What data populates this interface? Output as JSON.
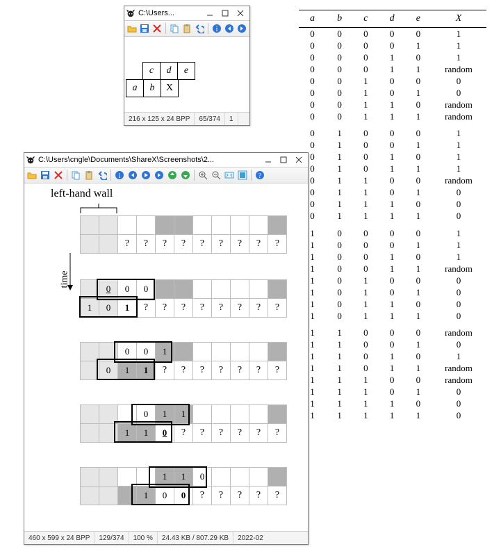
{
  "window1": {
    "title": "C:\\Users...",
    "status": {
      "dims": "216 x 125 x 24 BPP",
      "index": "65/374",
      "trail": "1"
    },
    "cells": {
      "c": "c",
      "d": "d",
      "e": "e",
      "a": "a",
      "b": "b",
      "X": "X"
    }
  },
  "window2": {
    "title": "C:\\Users\\cngle\\Documents\\ShareX\\Screenshots\\2...",
    "heading": "left-hand wall",
    "time_label": "time",
    "status": {
      "dims": "460 x 599 x 24 BPP",
      "index": "129/374",
      "zoom": "100 %",
      "size": "24.43 KB / 807.29 KB",
      "date": "2022-02"
    },
    "glyphs": {
      "zero": "0",
      "one": "1",
      "q": "?"
    }
  },
  "truth_table": {
    "headers": [
      "a",
      "b",
      "c",
      "d",
      "e",
      "X"
    ],
    "rows": [
      [
        "0",
        "0",
        "0",
        "0",
        "0",
        "1"
      ],
      [
        "0",
        "0",
        "0",
        "0",
        "1",
        "1"
      ],
      [
        "0",
        "0",
        "0",
        "1",
        "0",
        "1"
      ],
      [
        "0",
        "0",
        "0",
        "1",
        "1",
        "random"
      ],
      [
        "0",
        "0",
        "1",
        "0",
        "0",
        "0"
      ],
      [
        "0",
        "0",
        "1",
        "0",
        "1",
        "0"
      ],
      [
        "0",
        "0",
        "1",
        "1",
        "0",
        "random"
      ],
      [
        "0",
        "0",
        "1",
        "1",
        "1",
        "random"
      ],
      [
        "0",
        "1",
        "0",
        "0",
        "0",
        "1"
      ],
      [
        "0",
        "1",
        "0",
        "0",
        "1",
        "1"
      ],
      [
        "0",
        "1",
        "0",
        "1",
        "0",
        "1"
      ],
      [
        "0",
        "1",
        "0",
        "1",
        "1",
        "1"
      ],
      [
        "0",
        "1",
        "1",
        "0",
        "0",
        "random"
      ],
      [
        "0",
        "1",
        "1",
        "0",
        "1",
        "0"
      ],
      [
        "0",
        "1",
        "1",
        "1",
        "0",
        "0"
      ],
      [
        "0",
        "1",
        "1",
        "1",
        "1",
        "0"
      ],
      [
        "1",
        "0",
        "0",
        "0",
        "0",
        "1"
      ],
      [
        "1",
        "0",
        "0",
        "0",
        "1",
        "1"
      ],
      [
        "1",
        "0",
        "0",
        "1",
        "0",
        "1"
      ],
      [
        "1",
        "0",
        "0",
        "1",
        "1",
        "random"
      ],
      [
        "1",
        "0",
        "1",
        "0",
        "0",
        "0"
      ],
      [
        "1",
        "0",
        "1",
        "0",
        "1",
        "0"
      ],
      [
        "1",
        "0",
        "1",
        "1",
        "0",
        "0"
      ],
      [
        "1",
        "0",
        "1",
        "1",
        "1",
        "0"
      ],
      [
        "1",
        "1",
        "0",
        "0",
        "0",
        "random"
      ],
      [
        "1",
        "1",
        "0",
        "0",
        "1",
        "0"
      ],
      [
        "1",
        "1",
        "0",
        "1",
        "0",
        "1"
      ],
      [
        "1",
        "1",
        "0",
        "1",
        "1",
        "random"
      ],
      [
        "1",
        "1",
        "1",
        "0",
        "0",
        "random"
      ],
      [
        "1",
        "1",
        "1",
        "0",
        "1",
        "0"
      ],
      [
        "1",
        "1",
        "1",
        "1",
        "0",
        "0"
      ],
      [
        "1",
        "1",
        "1",
        "1",
        "1",
        "0"
      ]
    ]
  },
  "icons": {
    "open": "open-folder-icon",
    "save": "save-icon",
    "del": "delete-icon",
    "copy": "copy-icon",
    "paste": "paste-icon",
    "undo": "undo-icon",
    "info": "info-icon",
    "prev": "prev-icon",
    "next": "next-icon",
    "play": "play-icon",
    "up": "up-icon",
    "down": "down-icon",
    "zoomin": "zoom-in-icon",
    "zoomout": "zoom-out-icon",
    "fit": "fit-icon",
    "full": "fullscreen-icon",
    "help": "help-icon"
  }
}
